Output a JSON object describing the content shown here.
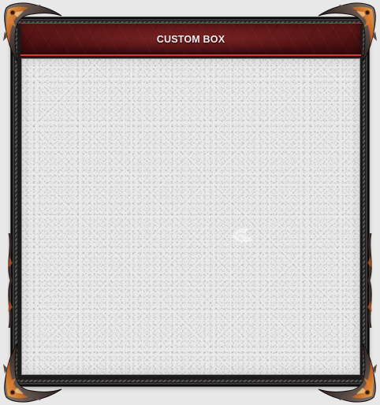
{
  "box": {
    "title": "CUSTOM BOX"
  },
  "icons": {
    "corner": "ornate-corner-icon",
    "watermark": "watermark-emblem-icon"
  },
  "colors": {
    "header": "#4e1213",
    "header_accent": "#d23a3a",
    "frame": "#1c1b1b",
    "panel": "#ebeaea",
    "ornament_fire": "#c45a1e"
  }
}
